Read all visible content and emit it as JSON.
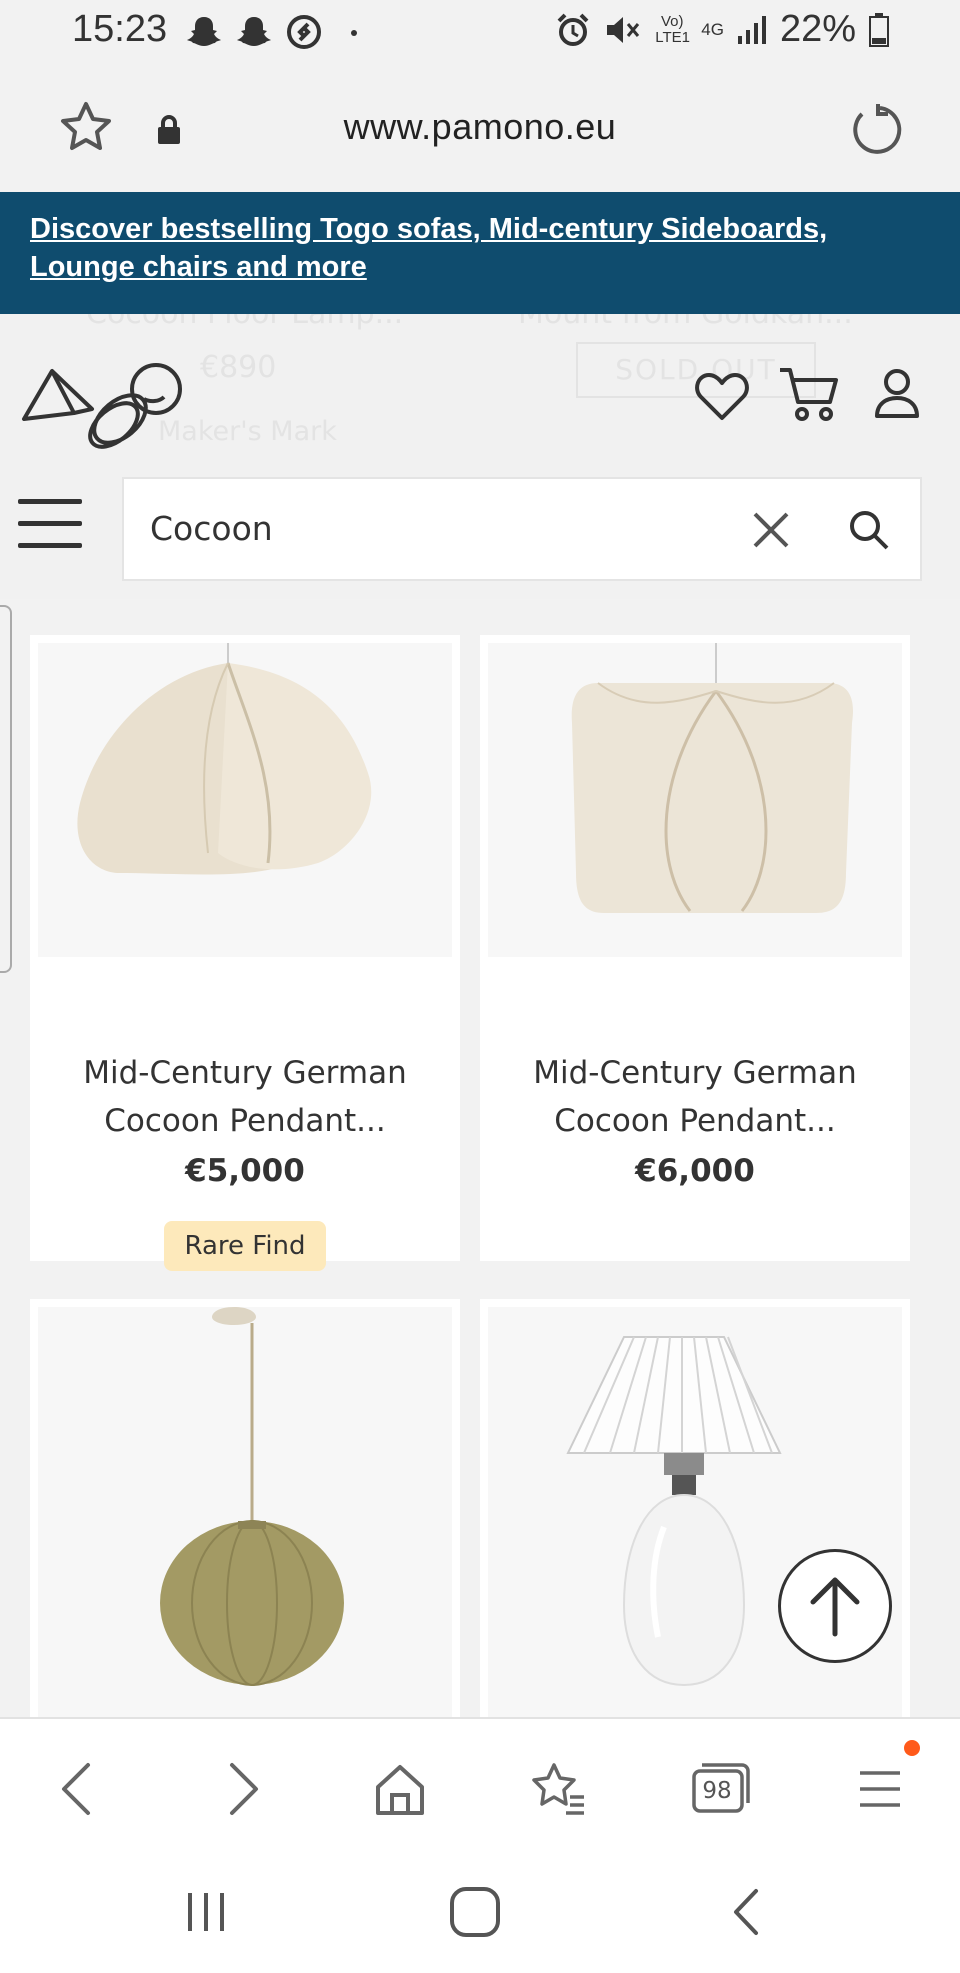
{
  "status_bar": {
    "time": "15:23",
    "network_label": "Vo) LTE1",
    "network_type": "4G",
    "battery": "22%",
    "icons": [
      "snapchat-icon",
      "snapchat-icon",
      "shazam-icon",
      "dot-icon",
      "alarm-icon",
      "mute-icon",
      "signal-icon",
      "battery-icon"
    ]
  },
  "address_bar": {
    "url": "www.pamono.eu"
  },
  "promo": {
    "text": "Discover bestselling Togo sofas, Mid-century Sideboards, Lounge chairs and more",
    "bg_color": "#0f4c6e"
  },
  "behind": {
    "title_1": "Cocoon Floor Lamp...",
    "price_1": "€890",
    "badge_1": "Maker's Mark",
    "title_2": "Mount from Goldkan...",
    "status_2": "SOLD OUT"
  },
  "search": {
    "value": "Cocoon"
  },
  "products": [
    {
      "title": "Mid-Century German Cocoon Pendant...",
      "price": "€5,000",
      "badge": "Rare Find"
    },
    {
      "title": "Mid-Century German Cocoon Pendant...",
      "price": "€6,000"
    }
  ],
  "toolbar": {
    "tabs_count": "98"
  },
  "colors": {
    "badge_bg": "#fde9bb",
    "notification_dot": "#ff5a1a"
  }
}
